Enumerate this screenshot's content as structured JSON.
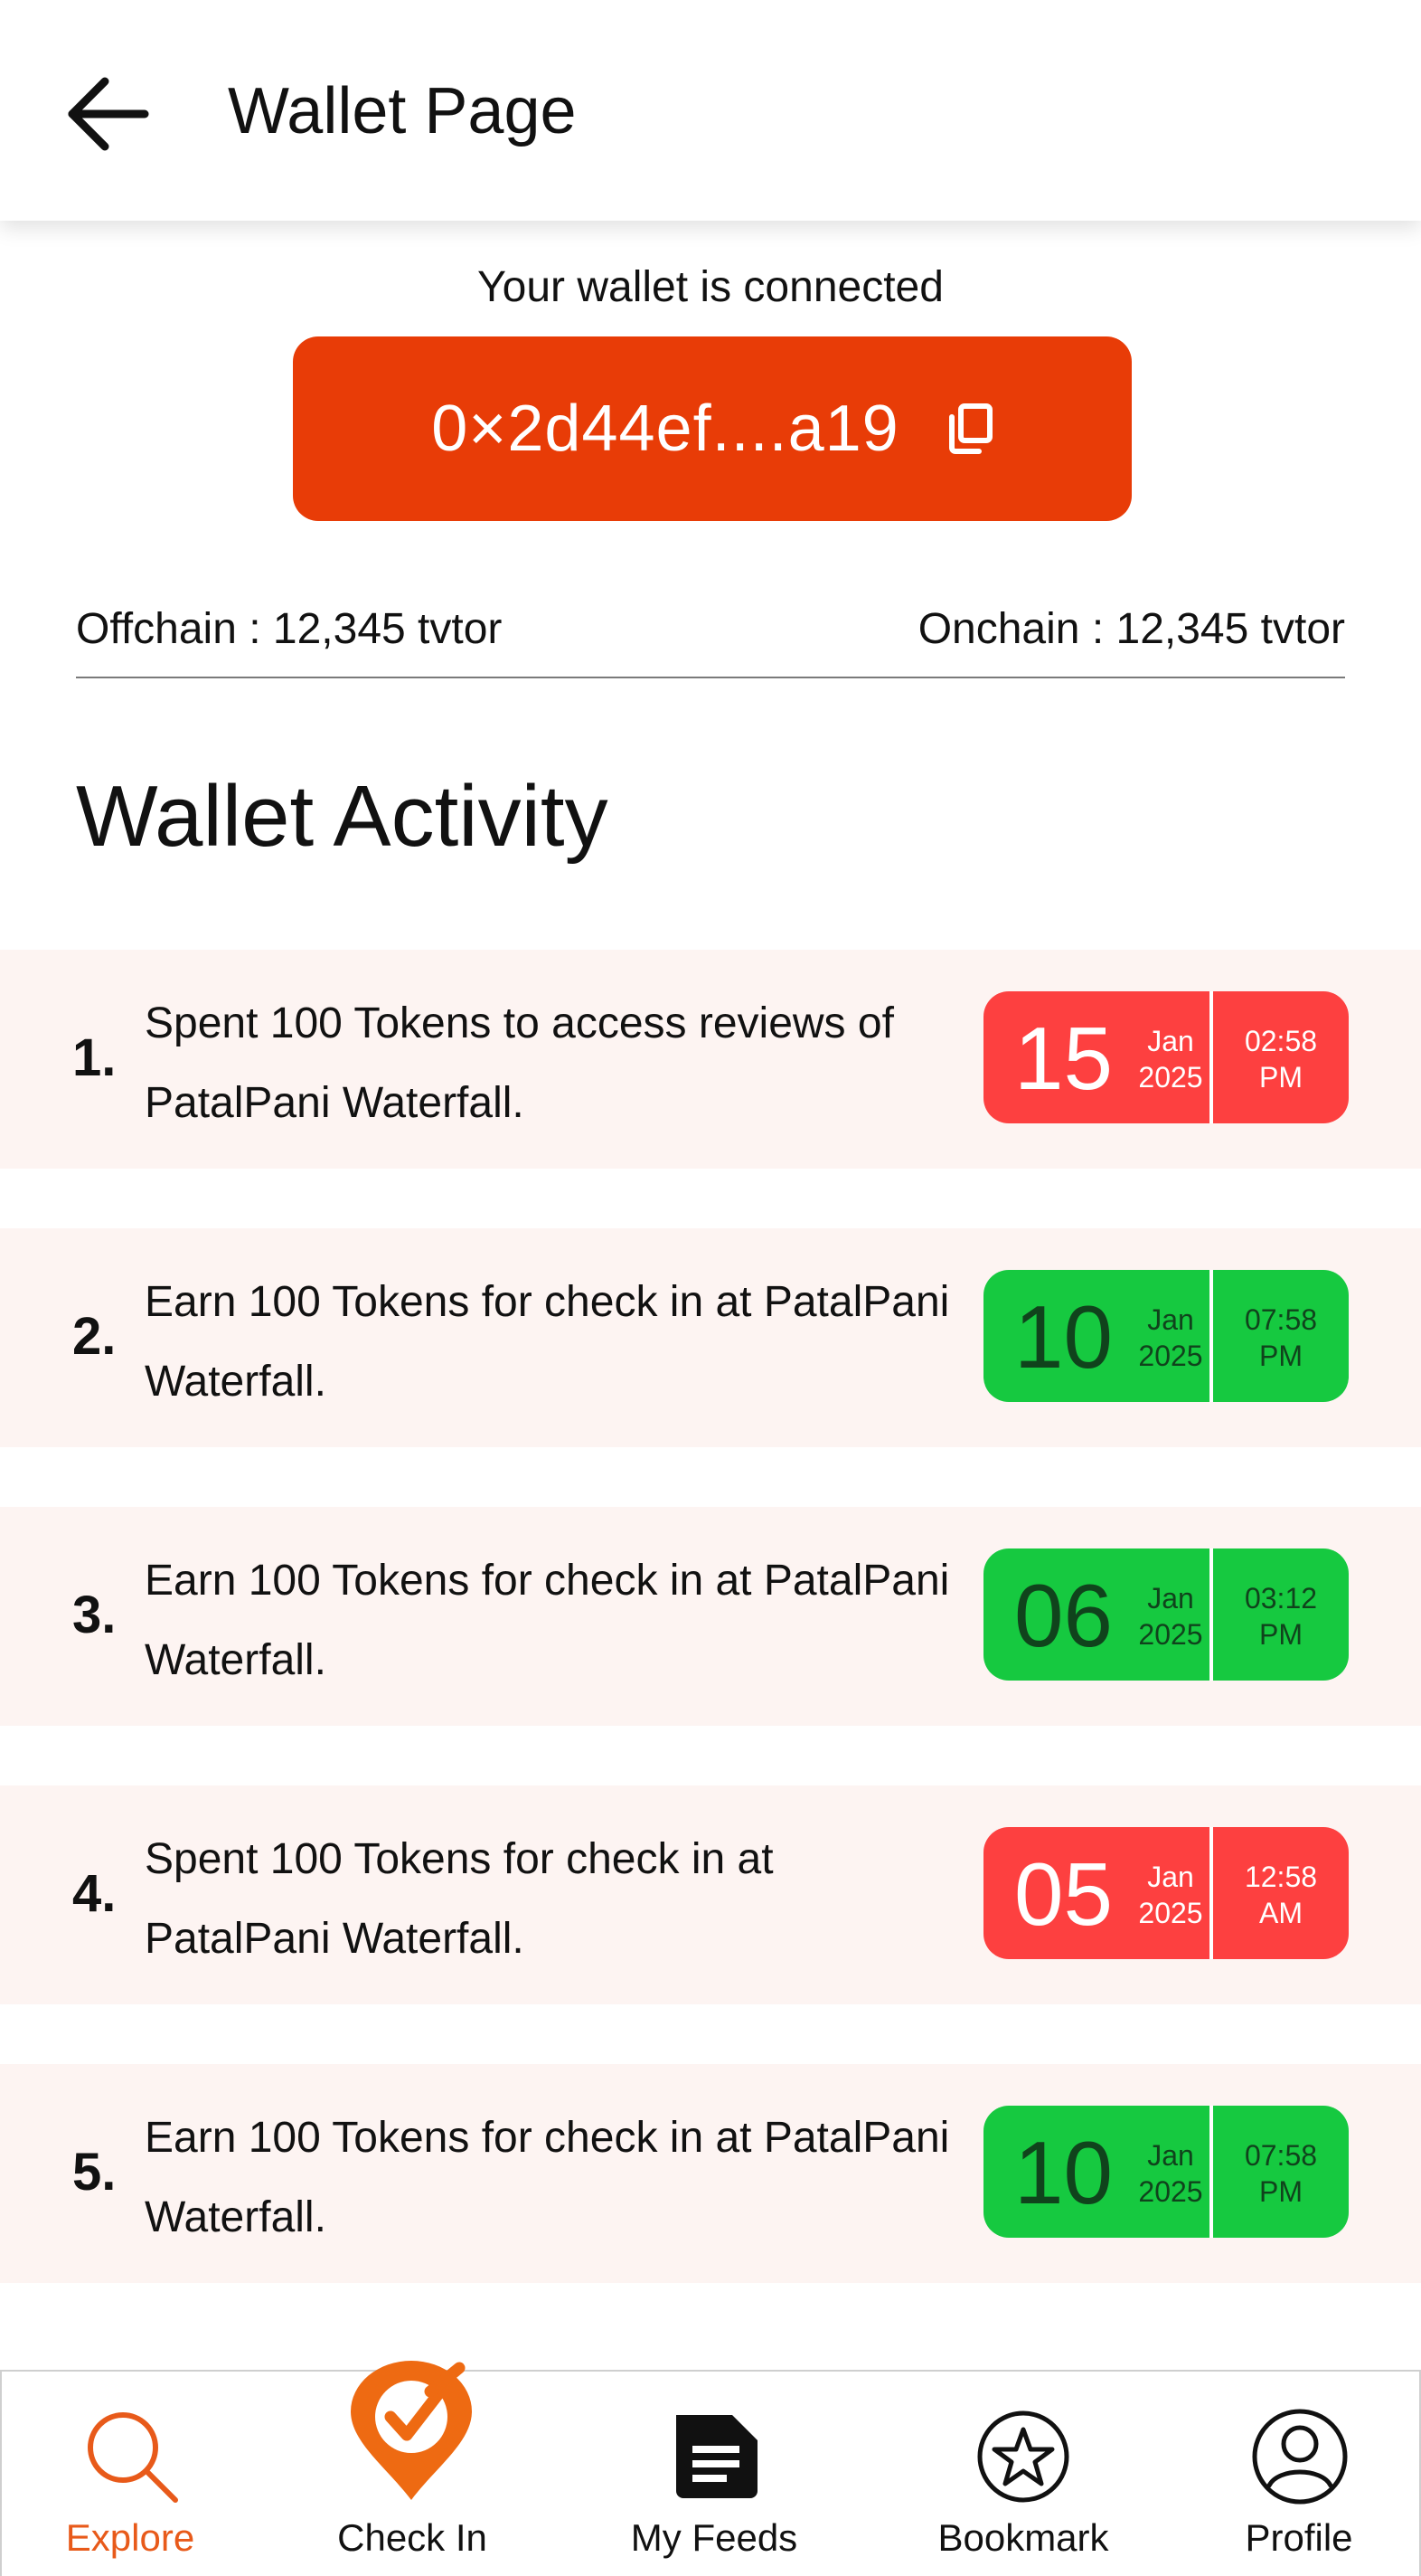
{
  "header": {
    "title": "Wallet Page",
    "back_icon": "arrow-left-icon"
  },
  "wallet": {
    "status_text": "Your wallet is connected",
    "address": "0×2d44ef....a19",
    "copy_icon": "copy-icon",
    "button_color": "#e83c07"
  },
  "balances": {
    "offchain": "Offchain : 12,345 tvtor",
    "onchain": "Onchain : 12,345 tvtor"
  },
  "activity": {
    "title": "Wallet Activity",
    "items": [
      {
        "num": "1.",
        "text": "Spent 100 Tokens to access reviews of PatalPani Waterfall.",
        "status": "red",
        "day": "15",
        "month": "Jan",
        "year": "2025",
        "time": "02:58",
        "ampm": "PM"
      },
      {
        "num": "2.",
        "text": "Earn 100 Tokens for check in at PatalPani Waterfall.",
        "status": "green",
        "day": "10",
        "month": "Jan",
        "year": "2025",
        "time": "07:58",
        "ampm": "PM"
      },
      {
        "num": "3.",
        "text": "Earn 100 Tokens for check in at PatalPani Waterfall.",
        "status": "green",
        "day": "06",
        "month": "Jan",
        "year": "2025",
        "time": "03:12",
        "ampm": "PM"
      },
      {
        "num": "4.",
        "text": "Spent 100 Tokens for check in at PatalPani Waterfall.",
        "status": "red",
        "day": "05",
        "month": "Jan",
        "year": "2025",
        "time": "12:58",
        "ampm": "AM"
      },
      {
        "num": "5.",
        "text": "Earn 100 Tokens for check in at PatalPani Waterfall.",
        "status": "green",
        "day": "10",
        "month": "Jan",
        "year": "2025",
        "time": "07:58",
        "ampm": "PM"
      }
    ],
    "colors": {
      "spent": "#fd4040",
      "earn": "#16c940",
      "row_bg": "#fdf4f2"
    }
  },
  "nav": {
    "explore": {
      "label": "Explore",
      "icon": "search-icon",
      "active": true
    },
    "checkin": {
      "label": "Check In",
      "icon": "check-in-pin-icon"
    },
    "feeds": {
      "label": "My Feeds",
      "icon": "document-icon"
    },
    "bookmark": {
      "label": "Bookmark",
      "icon": "star-icon"
    },
    "profile": {
      "label": "Profile",
      "icon": "user-icon"
    },
    "active_color": "#e85a1a"
  }
}
